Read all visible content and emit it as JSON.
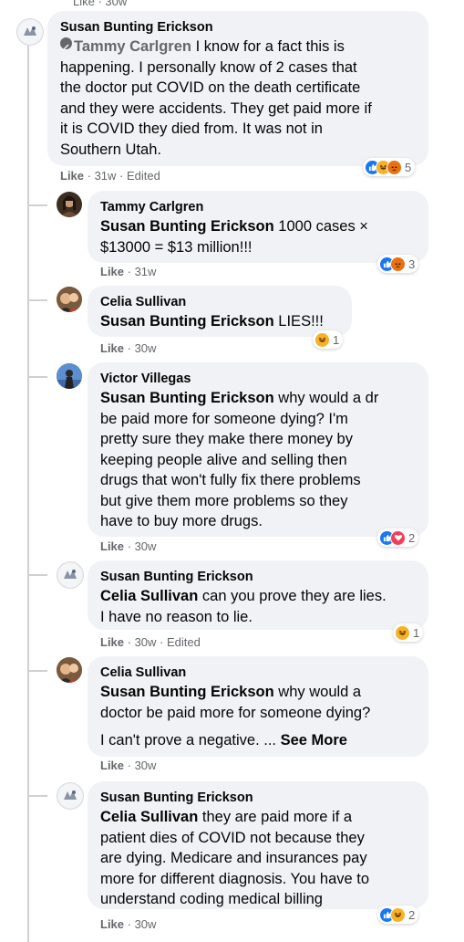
{
  "top_partial": "Like · 30w",
  "comments": [
    {
      "author": "Susan Bunting Erickson",
      "mention": "Tammy Carlgren",
      "text_lines": [
        "I know for a fact this is",
        "happening. I personally know of 2 cases that",
        "the doctor put COVID on the death certificate",
        "and they were accidents. They get paid more if",
        "it is COVID they died from. It was not in",
        "Southern Utah."
      ],
      "like": "Like",
      "time": "31w",
      "edited": "Edited",
      "reaction_count": "5"
    },
    {
      "author": "Tammy Carlgren",
      "mention": "Susan Bunting Erickson",
      "text_lines": [
        "1000 cases ×",
        "$13000 = $13 million!!!"
      ],
      "like": "Like",
      "time": "31w",
      "reaction_count": "3"
    },
    {
      "author": "Celia Sullivan",
      "mention": "Susan Bunting Erickson",
      "text_lines": [
        "LIES!!!"
      ],
      "like": "Like",
      "time": "30w",
      "reaction_count": "1"
    },
    {
      "author": "Victor Villegas",
      "mention": "Susan Bunting Erickson",
      "text_lines": [
        "why would a dr",
        "be paid more for someone dying? I'm",
        "pretty sure they make there money by",
        "keeping people alive and selling then",
        "drugs that won't fully fix there problems",
        "but give them more problems so they",
        "have to buy more drugs."
      ],
      "like": "Like",
      "time": "30w",
      "reaction_count": "2"
    },
    {
      "author": "Susan Bunting Erickson",
      "mention": "Celia Sullivan",
      "text_lines": [
        "can you prove they are lies.",
        "I have no reason to lie."
      ],
      "like": "Like",
      "time": "30w",
      "edited": "Edited",
      "reaction_count": "1"
    },
    {
      "author": "Celia Sullivan",
      "mention": "Susan Bunting Erickson",
      "text_lines": [
        "why would a",
        "doctor be paid more for someone dying?"
      ],
      "para2": "I can't prove a negative. ...",
      "see_more": "See More",
      "like": "Like",
      "time": "30w"
    },
    {
      "author": "Susan Bunting Erickson",
      "mention": "Celia Sullivan",
      "text_lines": [
        "they are paid more if a",
        "patient dies of COVID not because they",
        "are dying. Medicare and insurances pay",
        "more for different diagnosis. You have to",
        "understand coding medical billing"
      ],
      "like": "Like",
      "time": "30w",
      "reaction_count": "2"
    }
  ],
  "colors": {
    "like_blue": "#1877f2",
    "haha_yellow": "#f7b125",
    "angry_orange": "#e9710f",
    "love_red": "#f33e58",
    "bubble": "#f0f2f5"
  }
}
